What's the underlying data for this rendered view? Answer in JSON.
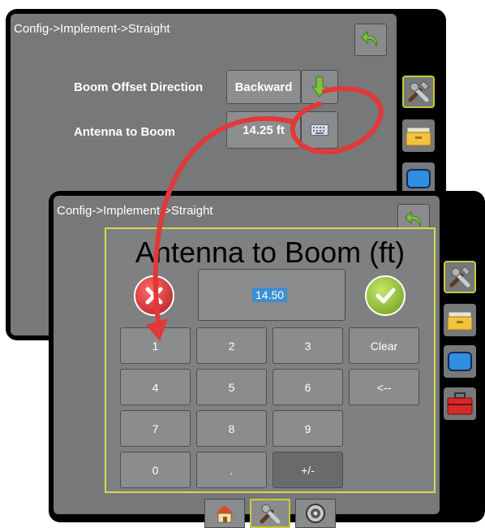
{
  "back_screen": {
    "breadcrumb": "Config->Implement->Straight",
    "boom_offset_label": "Boom Offset Direction",
    "boom_offset_value": "Backward",
    "antenna_label": "Antenna to Boom",
    "antenna_value": "14.25 ft"
  },
  "front_screen": {
    "breadcrumb": "Config->Implement->Straight"
  },
  "keypad": {
    "title": "Antenna to Boom (ft)",
    "display_value": "14.50",
    "keys": [
      "1",
      "2",
      "3",
      "Clear",
      "4",
      "5",
      "6",
      "<--",
      "7",
      "8",
      "9",
      "0",
      ".",
      "+/-"
    ]
  },
  "colors": {
    "arrow": "#e23838",
    "panel_border": "#d8d852",
    "selection": "#3d8fd1",
    "accept": "#8cbf2a",
    "cancel": "#c22a2a"
  },
  "icons": {
    "back": "back-arrow-icon",
    "down": "down-arrow-icon",
    "keyboard": "keyboard-icon",
    "tools": "tools-icon",
    "folder": "folder-icon",
    "screen": "screen-icon",
    "toolbox": "toolbox-icon",
    "home": "home-icon",
    "dial": "dial-icon"
  }
}
